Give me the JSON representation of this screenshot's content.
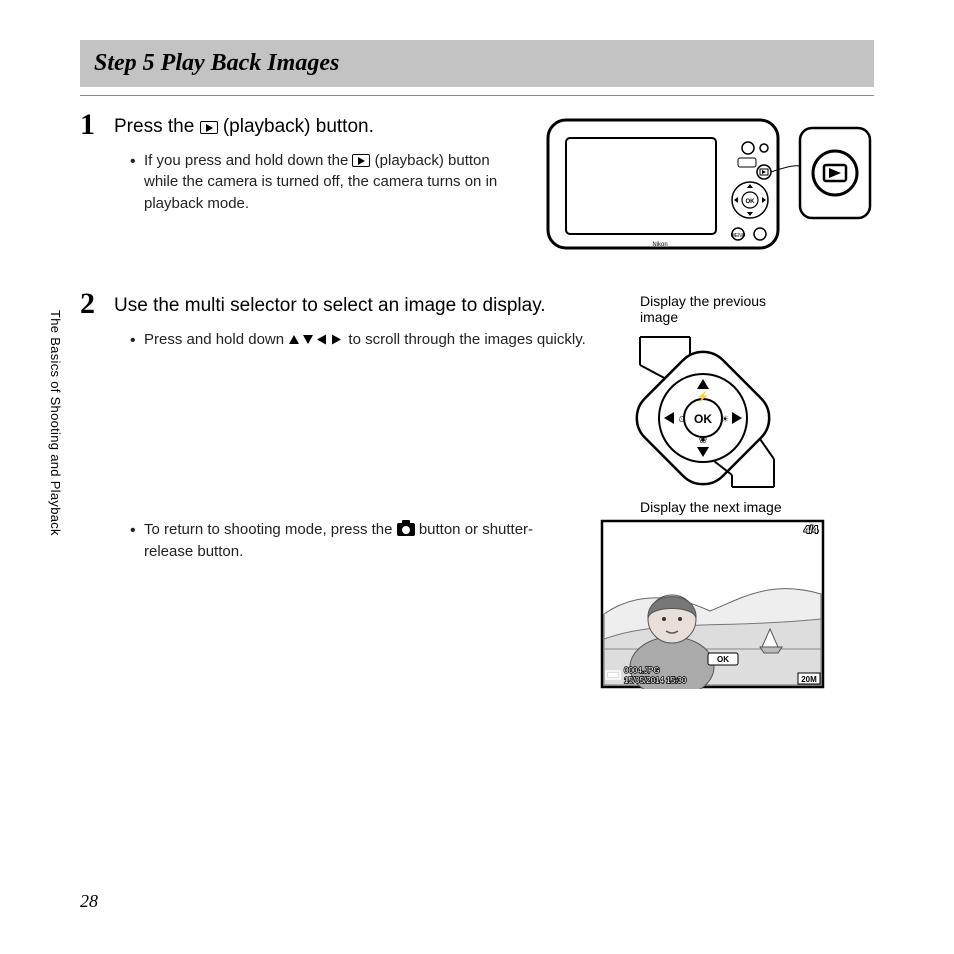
{
  "section_title": "Step 5 Play Back Images",
  "side_label": "The Basics of Shooting and Playback",
  "page_number": "28",
  "step1": {
    "num": "1",
    "heading_before": "Press the ",
    "heading_after": " (playback) button.",
    "bullet_before": "If you press and hold down the ",
    "bullet_after": " (playback) button while the camera is turned off, the camera turns on in playback mode."
  },
  "step2": {
    "num": "2",
    "heading": "Use the multi selector to select an image to display.",
    "bullet1_before": "Press and hold down ",
    "bullet1_after": " to scroll through the images quickly.",
    "bullet2_before": "To return to shooting mode, press the ",
    "bullet2_after": " button or shutter-release button.",
    "label_prev": "Display the previous image",
    "label_next": "Display the next image"
  },
  "screen": {
    "counter": "4/4",
    "filename": "0004.JPG",
    "datetime": "15/05/2014 15:30",
    "size": "20M",
    "ok": "OK"
  }
}
